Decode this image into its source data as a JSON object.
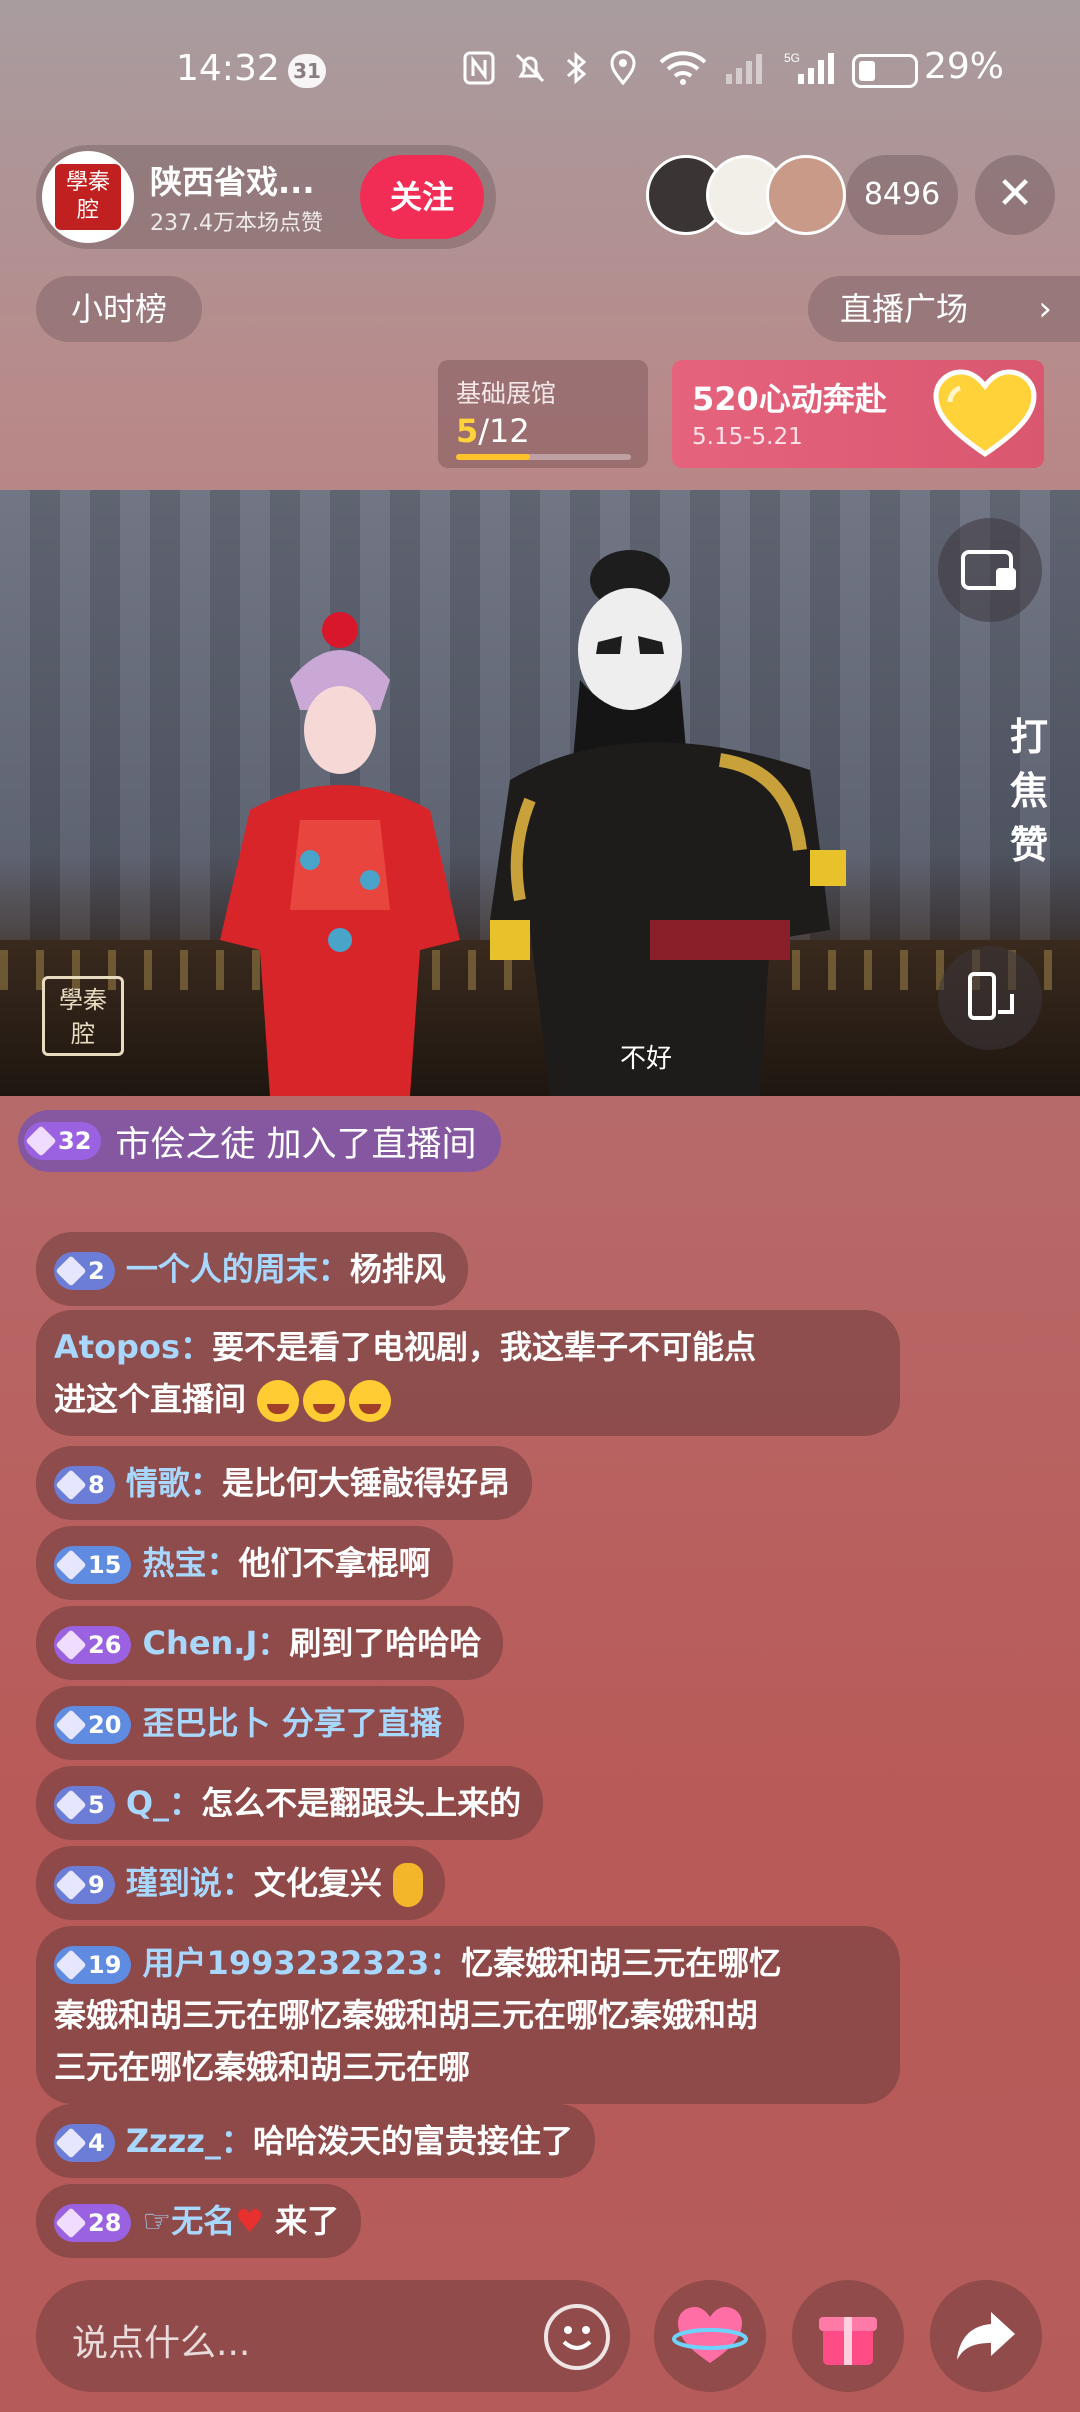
{
  "status_bar": {
    "time": "14:32",
    "badge": "31",
    "battery": "29%",
    "icons": [
      "nfc-icon",
      "mute-icon",
      "bluetooth-icon",
      "location-icon",
      "wifi-icon",
      "signal-icon",
      "5g-signal-icon",
      "battery-icon"
    ]
  },
  "host": {
    "name": "陕西省戏...",
    "likes": "237.4万本场点赞",
    "follow_label": "关注",
    "avatar_text": "學秦腔"
  },
  "viewer_count": "8496",
  "close_icon": "close-icon",
  "hour_rank": "小时榜",
  "live_plaza": "直播广场",
  "exhibit": {
    "title": "基础展馆",
    "current": "5",
    "total": "/12",
    "progress": 0.42
  },
  "promo": {
    "title": "520心动奔赴",
    "dates": "5.15-5.21"
  },
  "video": {
    "side_label": "打焦赞",
    "subtitle": "不好",
    "watermark": "學秦腔"
  },
  "join_banner": {
    "level": "32",
    "text": "市侩之徒 加入了直播间"
  },
  "chat": [
    {
      "level": "2",
      "user": "一个人的周末：",
      "content": "杨排风"
    },
    {
      "level": "",
      "user": "Atopos：",
      "content": "要不是看了电视剧，我这辈子不可能点",
      "content2": "进这个直播间"
    },
    {
      "level": "8",
      "user": "情歌：",
      "content": "是比何大锤敲得好昂"
    },
    {
      "level": "15",
      "user": "热宝：",
      "content": "他们不拿棍啊"
    },
    {
      "level": "26",
      "user": "Chen.J：",
      "content": "刷到了哈哈哈"
    },
    {
      "level": "20",
      "user": "歪巴比卜 分享了直播",
      "content": ""
    },
    {
      "level": "5",
      "user": "Q_：",
      "content": "怎么不是翻跟头上来的"
    },
    {
      "level": "9",
      "user": "瑾到说：",
      "content": "文化复兴"
    },
    {
      "level": "19",
      "user": "用户1993232323：",
      "content": "忆秦娥和胡三元在哪忆",
      "content2": "秦娥和胡三元在哪忆秦娥和胡三元在哪忆秦娥和胡",
      "content3": "三元在哪忆秦娥和胡三元在哪"
    },
    {
      "level": "4",
      "user": "Zzzz_：",
      "content": "哈哈泼天的富贵接住了"
    },
    {
      "level": "28",
      "user": "☞无名",
      "content": "来了"
    }
  ],
  "input": {
    "placeholder": "说点什么..."
  },
  "colors": {
    "follow": "#f22d55",
    "accent_yellow": "#ffc22b",
    "username": "#a8d8ff"
  }
}
